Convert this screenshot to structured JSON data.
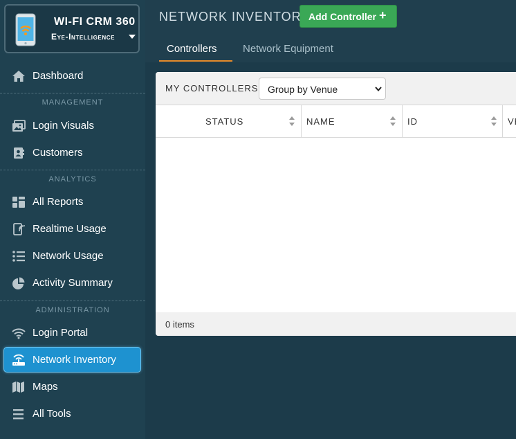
{
  "brand": {
    "title": "WI-FI CRM 360",
    "org": "Eye-Intelligence"
  },
  "sidebar": {
    "dashboard": "Dashboard",
    "sections": {
      "management": "MANAGEMENT",
      "analytics": "ANALYTICS",
      "administration": "ADMINISTRATION"
    },
    "items": {
      "login_visuals": "Login Visuals",
      "customers": "Customers",
      "all_reports": "All Reports",
      "realtime_usage": "Realtime Usage",
      "network_usage": "Network Usage",
      "activity_summary": "Activity Summary",
      "login_portal": "Login Portal",
      "network_inventory": "Network Inventory",
      "maps": "Maps",
      "all_tools": "All Tools"
    },
    "active": "network_inventory"
  },
  "header": {
    "page_title": "NETWORK INVENTORY",
    "add_button": "Add Controller",
    "add_icon": "+"
  },
  "tabs": [
    {
      "label": "Controllers",
      "active": true
    },
    {
      "label": "Network Equipment",
      "active": false
    }
  ],
  "card": {
    "caption": "MY CONTROLLERS",
    "group_select": {
      "value": "Group by Venue"
    },
    "columns": [
      "STATUS",
      "NAME",
      "ID",
      "VE"
    ],
    "rows": [],
    "footer": "0 items"
  },
  "colors": {
    "sidebar_bg": "#1f4150",
    "accent_active": "#1e92d0",
    "add_button": "#3aa856",
    "tab_underline": "#e58a2a",
    "icon_gray": "#b9c6cc"
  }
}
